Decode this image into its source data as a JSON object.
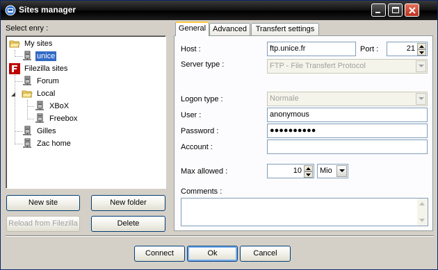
{
  "window": {
    "title": "Sites manager"
  },
  "tree": {
    "label": "Select enry  :",
    "nodes": [
      {
        "label": "My sites",
        "icon": "folder-open-icon"
      },
      {
        "label": "unice",
        "icon": "server-icon",
        "selected": true
      },
      {
        "label": "Filezilla sites",
        "icon": "filezilla-icon"
      },
      {
        "label": "Forum",
        "icon": "server-icon"
      },
      {
        "label": "Local",
        "icon": "folder-open-icon"
      },
      {
        "label": "XBoX",
        "icon": "server-icon"
      },
      {
        "label": "Freebox",
        "icon": "server-icon"
      },
      {
        "label": "Gilles",
        "icon": "server-icon"
      },
      {
        "label": "Zac home",
        "icon": "server-icon"
      }
    ]
  },
  "left_buttons": {
    "new_site": "New site",
    "new_folder": "New folder",
    "reload": "Reload from Filezilla",
    "delete": "Delete"
  },
  "tabs": [
    "General",
    "Advanced",
    "Transfert settings"
  ],
  "general": {
    "host_label": "Host :",
    "host_value": "ftp.unice.fr",
    "port_label": "Port :",
    "port_value": "21",
    "server_type_label": "Server type :",
    "server_type_value": "FTP - File Transfert Protocol",
    "logon_type_label": "Logon type :",
    "logon_type_value": "Normale",
    "user_label": "User :",
    "user_value": "anonymous",
    "password_label": "Password :",
    "password_value": "●●●●●●●●●●",
    "account_label": "Account :",
    "account_value": "",
    "max_allowed_label": "Max allowed :",
    "max_allowed_value": "10",
    "max_allowed_unit": "Mio",
    "comments_label": "Comments :",
    "comments_value": ""
  },
  "bottom_buttons": {
    "connect": "Connect",
    "ok": "Ok",
    "cancel": "Cancel"
  },
  "colors": {
    "selection": "#316ac5",
    "tab_highlight": "#ffc83c",
    "titlebar": "#000000"
  }
}
